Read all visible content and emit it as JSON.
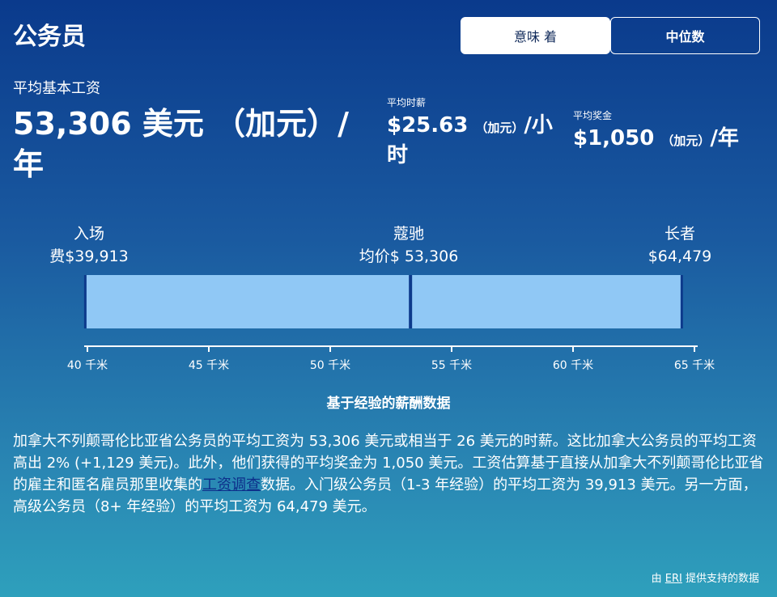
{
  "title": "公务员",
  "toggle": {
    "mean_label": "意味 着",
    "median_label": "中位数"
  },
  "salary": {
    "label": "平均基本工资",
    "value": "53,306 美元 （加元）/年"
  },
  "hourly": {
    "label": "平均时薪",
    "value": "$25.63",
    "currency": "（加元）",
    "per": "/小时"
  },
  "bonus": {
    "label": "平均奖金",
    "value": "$1,050",
    "currency": "（加元）",
    "per": "/年"
  },
  "range": {
    "entry": {
      "title": "入场",
      "value": "费$39,913"
    },
    "mid": {
      "title": "蔻驰",
      "value": "均价$ 53,306"
    },
    "senior": {
      "title": "长者",
      "value": "$64,479"
    }
  },
  "chart_data": {
    "type": "bar",
    "title": "基于经验的薪酬数据",
    "range_min": 39913,
    "median": 53306,
    "range_max": 64479,
    "xlim": [
      40000,
      65000
    ],
    "ticks": [
      {
        "value": 40000,
        "label": "40 千米"
      },
      {
        "value": 45000,
        "label": "45 千米"
      },
      {
        "value": 50000,
        "label": "50 千米"
      },
      {
        "value": 55000,
        "label": "55 千米"
      },
      {
        "value": 60000,
        "label": "60 千米"
      },
      {
        "value": 65000,
        "label": "65 千米"
      }
    ],
    "bar_color": "#90c8f5",
    "marker_color": "#0d3a8c"
  },
  "description": {
    "part1": "加拿大不列颠哥伦比亚省公务员的平均工资为 53,306 美元或相当于 26 美元的时薪。这比加拿大公务员的平均工资高出 2%  (+1,129 美元)。此外，他们获得的平均奖金为 1,050 美元。工资估算基于直接从加拿大不列颠哥伦比亚省的雇主和匿名雇员那里收集的",
    "link": "工资调查",
    "part2": "数据。入门级公务员（1-3 年经验）的平均工资为 39,913 美元。另一方面，高级公务员（8+ 年经验）的平均工资为 64,479 美元。"
  },
  "footer": {
    "prefix": "由 ",
    "link": "ERI",
    "suffix": " 提供支持的数据"
  }
}
